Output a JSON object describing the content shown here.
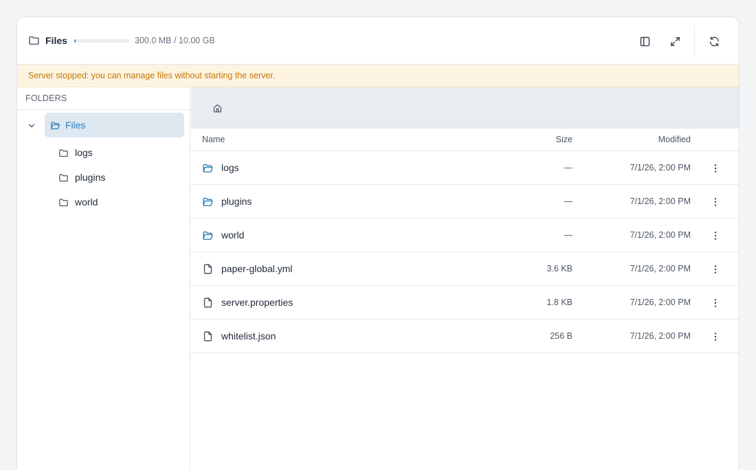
{
  "header": {
    "title": "Files",
    "title_icon": "folder-icon",
    "storage": {
      "used_text": "300.0 MB / 10.00 GB",
      "used_fraction": 0.029
    },
    "buttons": [
      "toggle-sidebar-icon",
      "expand-icon",
      "refresh-icon"
    ]
  },
  "banner": {
    "text": "Server stopped: you can manage files without starting the server.",
    "color": "#c47a09",
    "background": "#fdf3e1"
  },
  "sidebar": {
    "heading": "FOLDERS",
    "root": {
      "label": "Files",
      "expanded": true
    },
    "children": [
      {
        "label": "logs"
      },
      {
        "label": "plugins"
      },
      {
        "label": "world"
      }
    ]
  },
  "table": {
    "columns": {
      "name": "Name",
      "size": "Size",
      "modified": "Modified"
    },
    "rows": [
      {
        "type": "folder",
        "name": "logs",
        "size": "—",
        "modified": "7/1/26, 2:00 PM"
      },
      {
        "type": "folder",
        "name": "plugins",
        "size": "—",
        "modified": "7/1/26, 2:00 PM"
      },
      {
        "type": "folder",
        "name": "world",
        "size": "—",
        "modified": "7/1/26, 2:00 PM"
      },
      {
        "type": "file",
        "name": "paper-global.yml",
        "size": "3.6 KB",
        "modified": "7/1/26, 2:00 PM"
      },
      {
        "type": "file",
        "name": "server.properties",
        "size": "1.8 KB",
        "modified": "7/1/26, 2:00 PM"
      },
      {
        "type": "file",
        "name": "whitelist.json",
        "size": "256 B",
        "modified": "7/1/26, 2:00 PM"
      }
    ]
  },
  "colors": {
    "accent": "#2f7fb6",
    "selected_bg": "#dde8f1"
  }
}
